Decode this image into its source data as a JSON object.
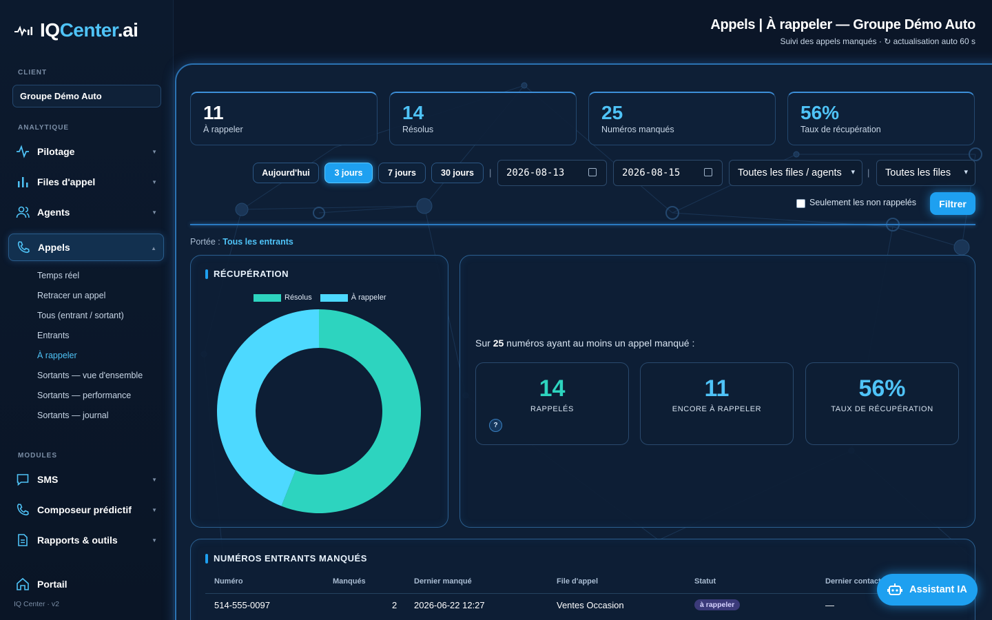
{
  "app": {
    "logo_prefix": "IQ",
    "logo_mid": "Center",
    "logo_suffix": ".ai",
    "version": "IQ Center · v2"
  },
  "header": {
    "title": "Appels | À rappeler — Groupe Démo Auto",
    "subtitle": "Suivi des appels manqués · ↻ actualisation auto 60 s"
  },
  "sidebar": {
    "client_label": "CLIENT",
    "client_value": "Groupe Démo Auto",
    "analytics_label": "ANALYTIQUE",
    "modules_label": "MODULES",
    "nav": [
      {
        "label": "Pilotage",
        "icon": "pulse-icon"
      },
      {
        "label": "Files d'appel",
        "icon": "bar-chart-icon"
      },
      {
        "label": "Agents",
        "icon": "users-icon"
      },
      {
        "label": "Appels",
        "icon": "phone-icon"
      }
    ],
    "sub": [
      "Temps réel",
      "Retracer un appel",
      "Tous (entrant / sortant)",
      "Entrants",
      "À rappeler",
      "Sortants — vue d'ensemble",
      "Sortants — performance",
      "Sortants — journal"
    ],
    "modules": [
      {
        "label": "SMS",
        "icon": "chat-icon"
      },
      {
        "label": "Composeur prédictif",
        "icon": "phone-icon"
      },
      {
        "label": "Rapports & outils",
        "icon": "document-icon"
      }
    ],
    "portal": "Portail"
  },
  "kpis": [
    {
      "value": "11",
      "label": "À rappeler",
      "color": "#ffffff"
    },
    {
      "value": "14",
      "label": "Résolus",
      "color": "#4fc3f7"
    },
    {
      "value": "25",
      "label": "Numéros manqués",
      "color": "#4fc3f7"
    },
    {
      "value": "56%",
      "label": "Taux de récupération",
      "color": "#4fc3f7"
    }
  ],
  "filters": {
    "ranges": [
      "Aujourd'hui",
      "3 jours",
      "7 jours",
      "30 jours"
    ],
    "active_range": "3 jours",
    "date_from": "2026-08-13",
    "date_to": "2026-08-15",
    "queue_select": "Toutes les files / agents",
    "file_select": "Toutes les files",
    "only_uncalled": "Seulement les non rappelés",
    "filter_button": "Filtrer"
  },
  "scope": {
    "label": "Portée :",
    "value": "Tous les entrants"
  },
  "recovery": {
    "title": "RÉCUPÉRATION",
    "legend_resolved": "Résolus",
    "legend_callback": "À rappeler"
  },
  "chart_data": {
    "type": "pie",
    "categories": [
      "Résolus",
      "À rappeler"
    ],
    "values": [
      14,
      11
    ],
    "colors": [
      "#2dd4bf",
      "#4dd9ff"
    ],
    "title": "RÉCUPÉRATION"
  },
  "summary": {
    "prefix": "Sur",
    "count": "25",
    "suffix": "numéros ayant au moins un appel manqué :",
    "cards": [
      {
        "value": "14",
        "label": "RAPPELÉS",
        "color": "#2dd4bf"
      },
      {
        "value": "11",
        "label": "ENCORE À RAPPELER",
        "color": "#4fc3f7"
      },
      {
        "value": "56%",
        "label": "TAUX DE RÉCUPÉRATION",
        "color": "#4fc3f7"
      }
    ],
    "help": "?"
  },
  "table": {
    "title": "NUMÉROS ENTRANTS MANQUÉS",
    "columns": [
      "Numéro",
      "Manqués",
      "Dernier manqué",
      "File d'appel",
      "Statut",
      "Dernier contact"
    ],
    "rows": [
      {
        "number": "514-555-0097",
        "missed": "2",
        "last_missed": "2026-06-22 12:27",
        "queue": "Ventes Occasion",
        "status": "à rappeler",
        "last_contact": "—"
      }
    ]
  },
  "assistant": {
    "label": "Assistant IA"
  },
  "colors": {
    "accent": "#1ea0f0",
    "resolved": "#2dd4bf",
    "callback": "#4dd9ff",
    "status_badge": "#3b3a7a"
  }
}
